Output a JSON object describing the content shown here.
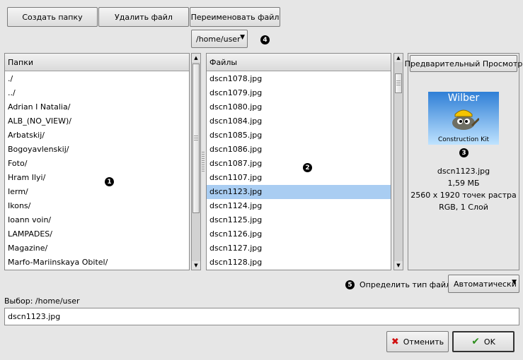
{
  "toolbar": {
    "create_folder": "Создать папку",
    "delete_file": "Удалить файл",
    "rename_file": "Переименовать файл"
  },
  "path_selector": {
    "value": "/home/user"
  },
  "callouts": {
    "one": "1",
    "two": "2",
    "three": "3",
    "four": "4",
    "five": "5"
  },
  "folders": {
    "header": "Папки",
    "items": [
      "./",
      "../",
      "Adrian I Natalia/",
      "ALB_(NO_VIEW)/",
      "Arbatskij/",
      "Bogoyavlenskij/",
      "Foto/",
      "Hram Ilyi/",
      "Ierm/",
      "Ikons/",
      "Ioann voin/",
      "LAMPADES/",
      "Magazine/",
      "Marfo-Mariinskaya Obitel/"
    ]
  },
  "files": {
    "header": "Файлы",
    "items": [
      "dscn1078.jpg",
      "dscn1079.jpg",
      "dscn1080.jpg",
      "dscn1084.jpg",
      "dscn1085.jpg",
      "dscn1086.jpg",
      "dscn1087.jpg",
      "dscn1107.jpg",
      "dscn1123.jpg",
      "dscn1124.jpg",
      "dscn1125.jpg",
      "dscn1126.jpg",
      "dscn1127.jpg",
      "dscn1128.jpg"
    ],
    "selected_index": 8
  },
  "preview": {
    "button": "Предварительный Просмотр",
    "thumb_title": "Wilber",
    "thumb_caption": "Construction Kit",
    "filename": "dscn1123.jpg",
    "size": "1,59 МБ",
    "dimensions": "2560 x 1920 точек растра",
    "mode": "RGB, 1 Слой"
  },
  "filetype": {
    "label": "Определить тип файла:",
    "value": "Автоматически"
  },
  "selection": {
    "label": "Выбор: /home/user",
    "value": "dscn1123.jpg"
  },
  "actions": {
    "cancel": "Отменить",
    "ok": "OK"
  },
  "colors": {
    "selection": "#a9cdf2",
    "background": "#e6e6e6"
  }
}
